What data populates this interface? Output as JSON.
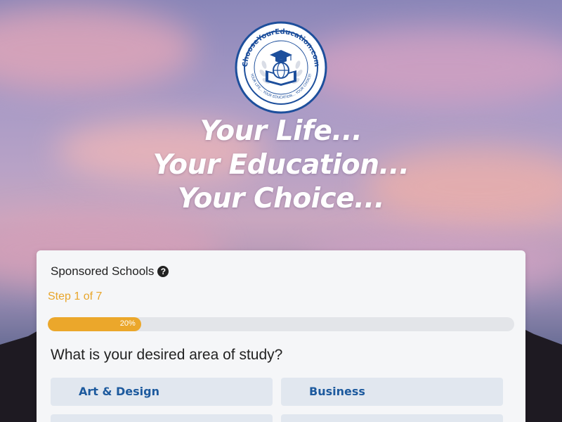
{
  "logo": {
    "brand_text": "ChooseYourEducation.com",
    "ring_text": "YOUR LIFE... YOUR EDUCATION... YOUR CHOICE!",
    "icon": "graduation-cap-globe-book-icon",
    "color": "#1d4f9c"
  },
  "hero": {
    "line1": "Your Life...",
    "line2": "Your Education...",
    "line3": "Your Choice..."
  },
  "form": {
    "sponsored_label": "Sponsored Schools",
    "help_icon": "question-circle-icon",
    "help_glyph": "?",
    "step_text": "Step 1 of 7",
    "progress_percent": 20,
    "progress_label": "20%",
    "question": "What is your desired area of study?",
    "options": [
      {
        "label": "Art & Design"
      },
      {
        "label": "Business"
      },
      {
        "label": ""
      },
      {
        "label": ""
      }
    ]
  },
  "colors": {
    "accent": "#eba72b",
    "option_text": "#1d5a9e",
    "option_bg": "#e1e7ef"
  }
}
